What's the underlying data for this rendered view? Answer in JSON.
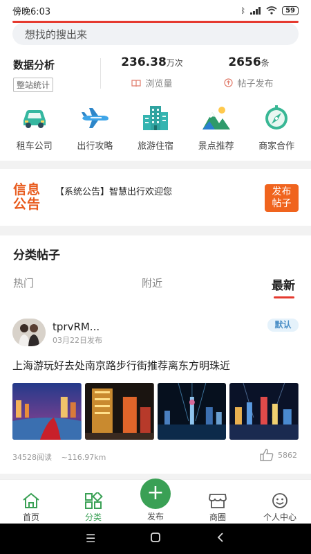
{
  "status": {
    "time": "傍晚6:03",
    "battery": "59"
  },
  "search": {
    "placeholder": "想找的搜出来"
  },
  "stats": {
    "title": "数据分析",
    "tag": "整站统计",
    "views": {
      "value": "236.38",
      "unit": "万次",
      "label": "浏览量"
    },
    "posts": {
      "value": "2656",
      "unit": "条",
      "label": "帖子发布"
    }
  },
  "categories": [
    "租车公司",
    "出行攻略",
    "旅游住宿",
    "景点推荐",
    "商家合作"
  ],
  "notice": {
    "logo_line1": "信息",
    "logo_line2": "公告",
    "text": "【系统公告】智慧出行欢迎您",
    "button_line1": "发布",
    "button_line2": "帖子"
  },
  "section_title": "分类帖子",
  "tabs": [
    "热门",
    "附近",
    "最新"
  ],
  "post": {
    "username": "tprvRM...",
    "date": "03月22日发布",
    "badge": "默认",
    "title": "上海游玩好去处南京路步行街推荐离东方明珠近",
    "reads": "34528阅读",
    "distance": "~116.97km",
    "likes": "5862"
  },
  "bottom_nav": [
    "首页",
    "分类",
    "发布",
    "商圈",
    "个人中心"
  ],
  "colors": {
    "accent_green": "#3aa055",
    "accent_red": "#e53a2f",
    "notice_orange": "#f0641e"
  }
}
